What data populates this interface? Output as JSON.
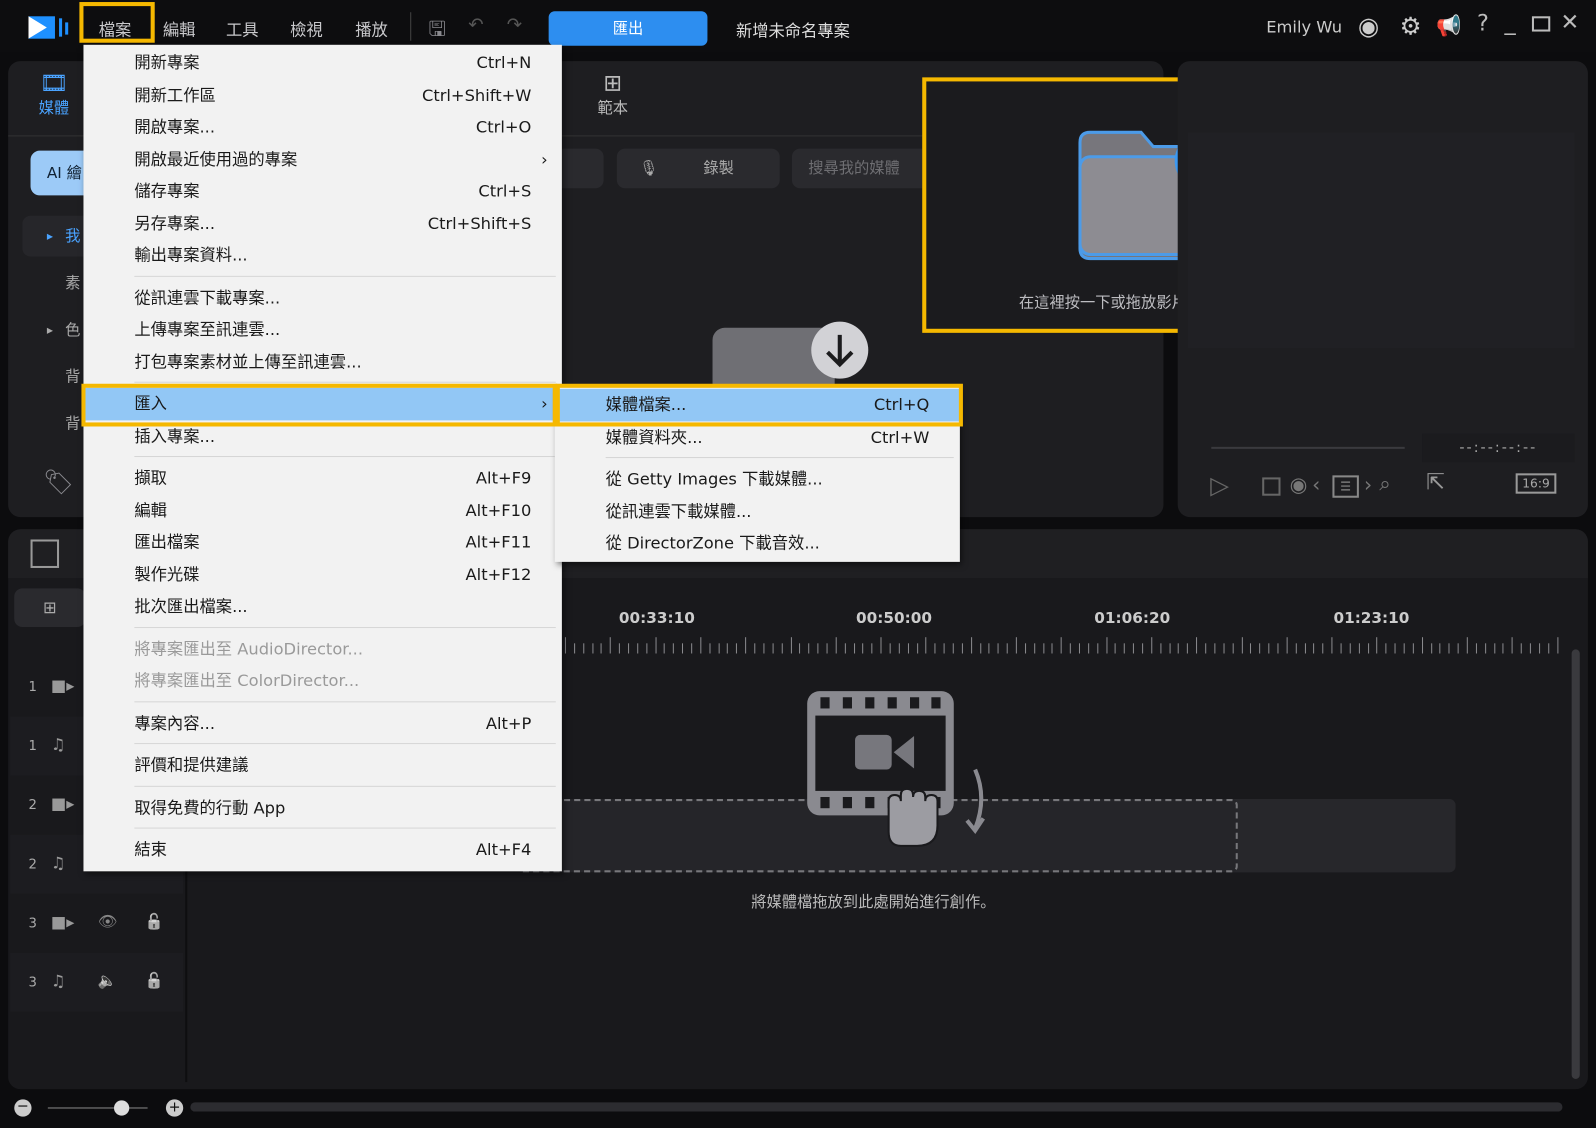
{
  "app": {
    "title": "新增未命名專案",
    "user": "Emily Wu",
    "export_label": "匯出"
  },
  "menubar": [
    "檔案",
    "編輯",
    "工具",
    "檢視",
    "播放"
  ],
  "colors": {
    "accent": "#2d8ef0",
    "highlight_box": "#f5b800",
    "menu_selected": "#92c7f5"
  },
  "library": {
    "tabs": [
      {
        "label": "媒體",
        "icon": "media-icon"
      },
      {
        "label": "範本",
        "icon": "template-icon"
      }
    ],
    "ai_button": "AI 繪",
    "record_label": "錄製",
    "search_placeholder": "搜尋我的媒體",
    "tree": [
      {
        "label": "我",
        "expand": true,
        "selected": true
      },
      {
        "label": "素"
      },
      {
        "label": "色",
        "expand": true
      },
      {
        "label": "背"
      },
      {
        "label": "背"
      }
    ],
    "drop_hint": "在這裡按一下或拖放影片、相片或音訊。"
  },
  "preview": {
    "timecode": "--:--:--:--",
    "aspect": "16:9"
  },
  "timeline": {
    "ruler": [
      "00:33:10",
      "00:50:00",
      "01:06:20",
      "01:23:10"
    ],
    "tracks": [
      {
        "num": "1",
        "type": "video"
      },
      {
        "num": "1",
        "type": "audio"
      },
      {
        "num": "2",
        "type": "video"
      },
      {
        "num": "2",
        "type": "audio"
      },
      {
        "num": "3",
        "type": "video"
      },
      {
        "num": "3",
        "type": "audio"
      }
    ],
    "drop_hint": "將媒體檔拖放到此處開始進行創作。"
  },
  "file_menu": [
    {
      "label": "開新專案",
      "shortcut": "Ctrl+N"
    },
    {
      "label": "開新工作區",
      "shortcut": "Ctrl+Shift+W"
    },
    {
      "label": "開啟專案...",
      "shortcut": "Ctrl+O"
    },
    {
      "label": "開啟最近使用過的專案",
      "submenu": true
    },
    {
      "label": "儲存專案",
      "shortcut": "Ctrl+S"
    },
    {
      "label": "另存專案...",
      "shortcut": "Ctrl+Shift+S"
    },
    {
      "label": "輸出專案資料..."
    },
    {
      "label": "從訊連雲下載專案...",
      "sep": true
    },
    {
      "label": "上傳專案至訊連雲..."
    },
    {
      "label": "打包專案素材並上傳至訊連雲..."
    },
    {
      "label": "匯入",
      "submenu": true,
      "sep": true,
      "selected": true
    },
    {
      "label": "插入專案..."
    },
    {
      "label": "擷取",
      "shortcut": "Alt+F9",
      "sep": true
    },
    {
      "label": "編輯",
      "shortcut": "Alt+F10"
    },
    {
      "label": "匯出檔案",
      "shortcut": "Alt+F11"
    },
    {
      "label": "製作光碟",
      "shortcut": "Alt+F12"
    },
    {
      "label": "批次匯出檔案..."
    },
    {
      "label": "將專案匯出至 AudioDirector...",
      "sep": true,
      "disabled": true
    },
    {
      "label": "將專案匯出至 ColorDirector...",
      "disabled": true
    },
    {
      "label": "專案內容...",
      "shortcut": "Alt+P",
      "sep": true
    },
    {
      "label": "評價和提供建議",
      "sep": true
    },
    {
      "label": "取得免費的行動 App",
      "sep": true
    },
    {
      "label": "結束",
      "shortcut": "Alt+F4",
      "sep": true
    }
  ],
  "import_submenu": [
    {
      "label": "媒體檔案...",
      "shortcut": "Ctrl+Q",
      "selected": true
    },
    {
      "label": "媒體資料夾...",
      "shortcut": "Ctrl+W"
    },
    {
      "label": "從 Getty Images 下載媒體...",
      "sep": true
    },
    {
      "label": "從訊連雲下載媒體..."
    },
    {
      "label": "從 DirectorZone 下載音效..."
    }
  ]
}
